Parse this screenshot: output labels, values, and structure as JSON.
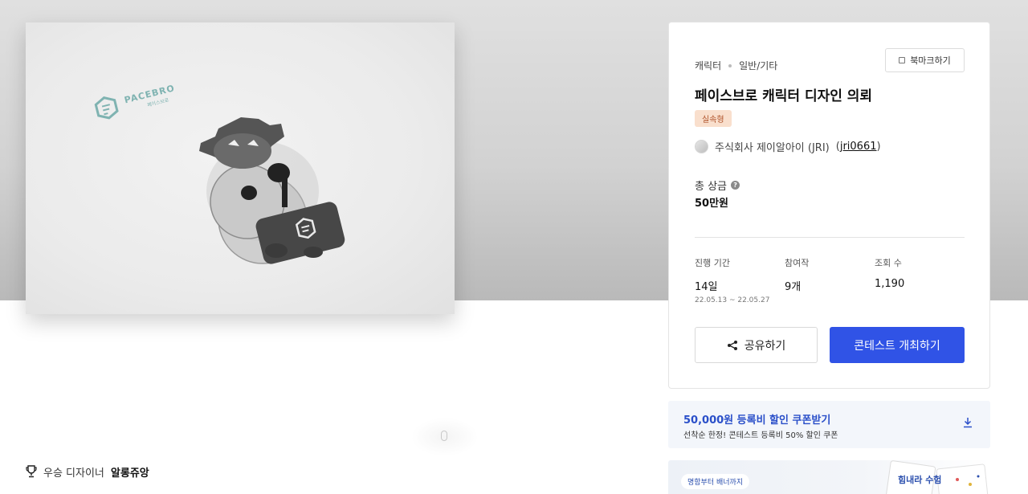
{
  "hero": {
    "logo_text": "PACEBRO",
    "logo_sub": "페이스브로"
  },
  "winner": {
    "prefix": "우승 디자이너",
    "name": "알롱쥬앙"
  },
  "contest": {
    "category": "캐릭터",
    "subcategory": "일반/기타",
    "bookmark_label": "북마크하기",
    "title": "페이스브로 캐릭터 디자인 의뢰",
    "badge": "실속형",
    "host_name": "주식회사 제이알아이 (JRI)",
    "host_paren_open": "(",
    "host_handle": "jri0661",
    "host_paren_close": ")",
    "prize_label": "총 상금",
    "help_mark": "?",
    "prize_value": "50만원",
    "stats": {
      "period_label": "진행 기간",
      "period_value": "14일",
      "period_range": "22.05.13 ~ 22.05.27",
      "entries_label": "참여작",
      "entries_value": "9개",
      "views_label": "조회 수",
      "views_value": "1,190"
    },
    "share_label": "공유하기",
    "host_button_label": "콘테스트 개최하기"
  },
  "coupon": {
    "title": "50,000원 등록비 할인 쿠폰받기",
    "subtitle": "선착순 한정! 콘테스트 등록비 50% 할인 쿠폰"
  },
  "banner": {
    "pill": "명함부터 배너까지",
    "art_text": "힘내라 수험"
  },
  "colors": {
    "primary": "#3053e6",
    "coupon_text": "#2a4fc9",
    "badge_bg": "#f9dfcd",
    "badge_text": "#b0532a",
    "logo_teal": "#7fb3b1"
  },
  "icons": {
    "trophy": "trophy-icon",
    "share": "share-icon",
    "download": "download-icon",
    "bookmark": "bookmark-icon",
    "help": "help-icon"
  }
}
